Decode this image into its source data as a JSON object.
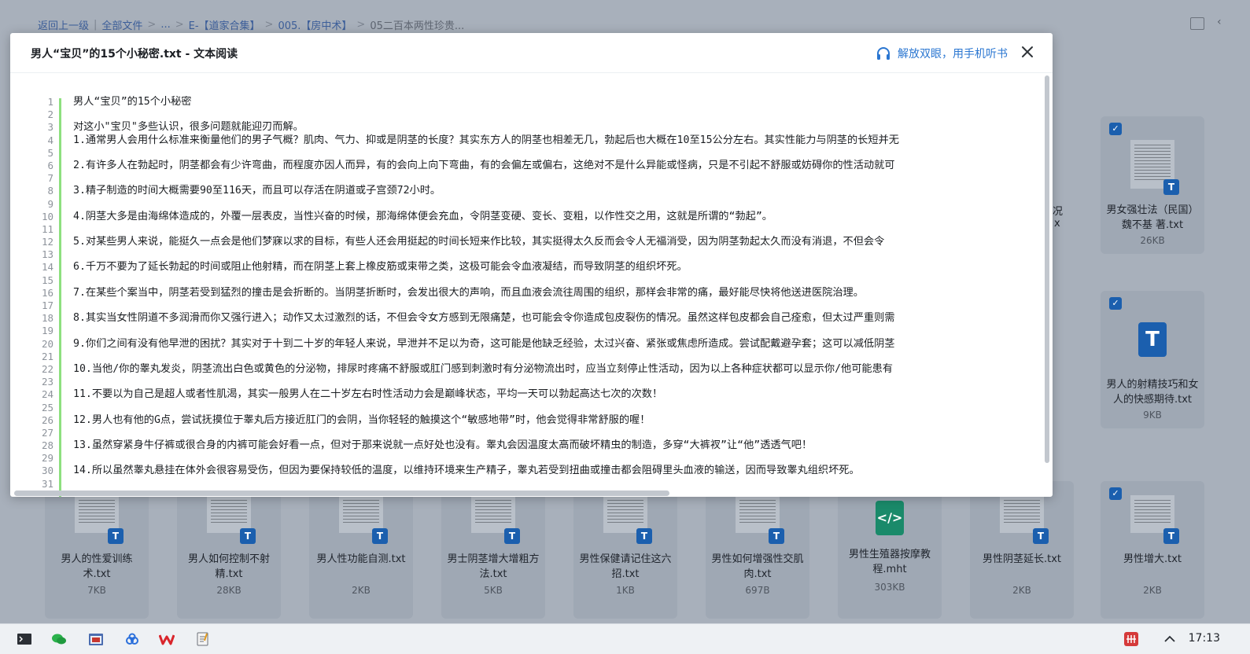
{
  "background": {
    "breadcrumb": [
      "返回上一级",
      "全部文件",
      "...",
      "E-【道家合集】",
      "005.【房中术】",
      "05二百本两性珍贵..."
    ],
    "right_tiles": [
      {
        "name": "男女强壮法（民国）魏不基 著.txt",
        "size": "26KB",
        "kind": "doc"
      },
      {
        "name": "男人的射精技巧和女人的快感期待.txt",
        "size": "9KB",
        "kind": "txt"
      }
    ],
    "bottom_tiles": [
      {
        "name": "男人的性爱训练术.txt",
        "size": "7KB",
        "kind": "doc"
      },
      {
        "name": "男人如何控制不射精.txt",
        "size": "28KB",
        "kind": "doc"
      },
      {
        "name": "男人性功能自测.txt",
        "size": "2KB",
        "kind": "doc"
      },
      {
        "name": "男士阴茎增大增粗方法.txt",
        "size": "5KB",
        "kind": "doc"
      },
      {
        "name": "男性保健请记住这六招.txt",
        "size": "1KB",
        "kind": "doc"
      },
      {
        "name": "男性如何增强性交肌肉.txt",
        "size": "697B",
        "kind": "doc"
      },
      {
        "name": "男性生殖器按摩教程.mht",
        "size": "303KB",
        "kind": "mht"
      },
      {
        "name": "男性阴茎延长.txt",
        "size": "2KB",
        "kind": "doc"
      },
      {
        "name": "男性增大.txt",
        "size": "2KB",
        "kind": "doc"
      }
    ],
    "partial_text": {
      "a": "况",
      "b": "x"
    }
  },
  "modal": {
    "title": "男人“宝贝”的15个小秘密.txt - 文本阅读",
    "listen_label": "解放双眼，用手机听书",
    "lines": [
      "男人“宝贝”的15个小秘密",
      "",
      "对这小\"宝贝\"多些认识，很多问题就能迎刃而解。",
      "1.通常男人会用什么标准来衡量他们的男子气概？肌肉、气力、抑或是阴茎的长度？其实东方人的阴茎也相差无几，勃起后也大概在10至15公分左右。其实性能力与阴茎的长短并无",
      "",
      "2.有许多人在勃起时，阴茎都会有少许弯曲，而程度亦因人而异，有的会向上向下弯曲，有的会偏左或偏右，这绝对不是什么异能或怪病，只是不引起不舒服或妨碍你的性活动就可",
      "",
      "3.精子制造的时间大概需要90至116天，而且可以存活在阴道或子宫颈72小时。",
      "",
      "4.阴茎大多是由海绵体造成的，外覆一层表皮，当性兴奋的时候，那海绵体便会充血，令阴茎变硬、变长、变粗，以作性交之用，这就是所谓的“勃起”。",
      "",
      "5.对某些男人来说，能挺久一点会是他们梦寐以求的目标，有些人还会用挺起的时间长短来作比较，其实挺得太久反而会令人无福消受，因为阴茎勃起太久而没有消退，不但会令",
      "",
      "6.千万不要为了延长勃起的时间或阻止他射精，而在阴茎上套上橡皮筋或束带之类，这极可能会令血液凝结，而导致阴茎的组织坏死。",
      "",
      "7.在某些个案当中，阴茎若受到猛烈的撞击是会折断的。当阴茎折断时，会发出很大的声响，而且血液会流往周围的组织，那样会非常的痛，最好能尽快将他送进医院治理。",
      "",
      "8.其实当女性阴道不多润滑而你又强行进入；动作又太过激烈的话，不但会令女方感到无限痛楚，也可能会令你造成包皮裂伤的情况。虽然这样包皮都会自己痊愈，但太过严重则需",
      "",
      "9.你们之间有没有他早泄的困扰？其实对于十到二十岁的年轻人来说，早泄并不足以为奇，这可能是他缺乏经验，太过兴奋、紧张或焦虑所造成。尝试配戴避孕套；这可以减低阴茎",
      "",
      "10.当他/你的睾丸发炎，阴茎流出白色或黄色的分泌物，排尿时疼痛不舒服或肛门感到刺激时有分泌物流出时，应当立刻停止性活动，因为以上各种症状都可以显示你/他可能患有",
      "",
      "11.不要以为自己是超人或者性肌渴，其实一般男人在二十岁左右时性活动力会是巅峰状态，平均一天可以勃起高达七次的次数！",
      "",
      "12.男人也有他的G点，尝试抚摸位于睾丸后方接近肛门的会阴，当你轻轻的触摸这个“敏感地带”时，他会觉得非常舒服的喔！",
      "",
      "13.虽然穿紧身牛仔裤或很合身的内裤可能会好看一点，但对于那来说就一点好处也没有。睾丸会因温度太高而破坏精虫的制造，多穿“大裤衩”让“他”透透气吧！",
      "",
      "14.所以虽然睾丸悬挂在体外会很容易受伤，但因为要保持较低的温度，以维持环境来生产精子，睾丸若受到扭曲或撞击都会阻碍里头血液的输送，因而导致睾丸组织坏死。",
      ""
    ],
    "line_numbers": [
      "1",
      "2",
      "3",
      "4",
      "5",
      "6",
      "7",
      "8",
      "9",
      "10",
      "11",
      "12",
      "13",
      "14",
      "15",
      "16",
      "17",
      "18",
      "19",
      "20",
      "21",
      "22",
      "23",
      "24",
      "25",
      "26",
      "27",
      "28",
      "29",
      "30",
      "31"
    ]
  },
  "taskbar": {
    "clock": "17:13",
    "icons": [
      "terminal-icon",
      "wechat-icon",
      "file-manager-icon",
      "baidu-netdisk-icon",
      "wps-icon",
      "notes-icon"
    ]
  },
  "colors": {
    "accent": "#2a76d1",
    "gutter_bar": "#8ee07f",
    "checkbox": "#1b5fae"
  }
}
